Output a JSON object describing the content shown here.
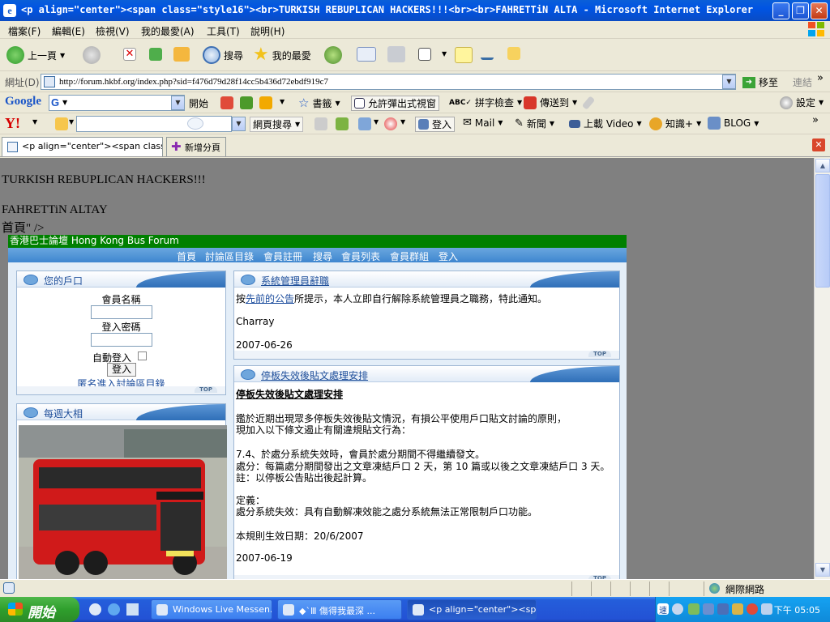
{
  "window": {
    "title": "<p align=\"center\"><span class=\"style16\"><br>TURKISH REBUPLICAN HACKERS!!!<br><br>FAHRETTiN ALTA - Microsoft Internet Explorer",
    "minimize": "_",
    "maximize": "❐",
    "close": "✕"
  },
  "menu": [
    "檔案(F)",
    "編輯(E)",
    "檢視(V)",
    "我的最愛(A)",
    "工具(T)",
    "說明(H)"
  ],
  "toolbar": {
    "back": "上一頁",
    "search": "搜尋",
    "favorites": "我的最愛"
  },
  "address": {
    "label": "網址(D)",
    "url": "http://forum.hkbf.org/index.php?sid=f476d79d28f14cc5b436d72ebdf919c7",
    "go": "移至",
    "links": "連結"
  },
  "google": {
    "logo": "Google",
    "query_prefix": "G",
    "start": "開始",
    "bookmarks": "書籤",
    "popups": "允許彈出式視窗",
    "spell": "拼字檢查",
    "send": "傳送到",
    "settings": "設定"
  },
  "yahoo": {
    "logo": "Y!",
    "web_search": "網頁搜尋",
    "login": "登入",
    "mail": "Mail",
    "news": "新聞",
    "video": "上載 Video",
    "knowledge": "知識+",
    "blog": "BLOG"
  },
  "tabs": {
    "active": "<p align=\"center\"><span class=\"st...",
    "new_tab": "新增分頁"
  },
  "page": {
    "hack_line1": "TURKISH REBUPLICAN HACKERS!!!",
    "hack_line2": "FAHRETTiN ALTAY",
    "hack_line3": "首頁\" />",
    "forum_title": "香港巴士論壇 Hong Kong Bus Forum",
    "nav": [
      "首頁",
      "討論區目錄",
      "會員註冊",
      "搜尋",
      "會員列表",
      "會員群組",
      "登入"
    ],
    "login_panel": {
      "title": "您的戶口",
      "username_label": "會員名稱",
      "password_label": "登入密碼",
      "auto_login": "自動登入",
      "login_button": "登入",
      "anon_link": "匿名進入討論區目錄"
    },
    "weekly_photo": {
      "title": "每週大相"
    },
    "resign_panel": {
      "title": "系統管理員辭職",
      "text_before": "按",
      "link_text": "先前的公告",
      "text_after": "所提示，本人立即自行解除系統管理員之職務，特此通知。",
      "author": "Charray",
      "date": "2007-06-26"
    },
    "rules_panel": {
      "title": "停板失效後貼文處理安排",
      "heading": "停板失效後貼文處理安排",
      "p1": "鑑於近期出現眾多停板失效後貼文情況，有損公平使用戶口貼文討論的原則，",
      "p2": "現加入以下條文遏止有關違規貼文行為：",
      "p3": "7.4、於處分系統失效時，會員於處分期間不得繼續發文。",
      "p4": "處分：每篇處分期間發出之文章凍結戶口 2 天，第 10 篇或以後之文章凍結戶口 3 天。",
      "p5": "註：以停板公告貼出後起計算。",
      "p6": "定義：",
      "p7": "處分系統失效：具有自動解凍效能之處分系統無法正常限制戶口功能。",
      "p8": "本規則生效日期：20/6/2007",
      "date": "2007-06-19"
    },
    "top_label": "TOP"
  },
  "status": {
    "zone": "網際網路"
  },
  "taskbar": {
    "start": "開始",
    "tasks": [
      "Windows Live Messen...",
      "◆`Ⅲ 傷得我最深 ...",
      "<p align=\"center\"><sp..."
    ],
    "clock": "下午 05:05"
  },
  "colors": {
    "forum_header": "#008000",
    "viewport_bg": "#808080",
    "taskbar": "#2352d5",
    "start": "#2f9f2d"
  }
}
